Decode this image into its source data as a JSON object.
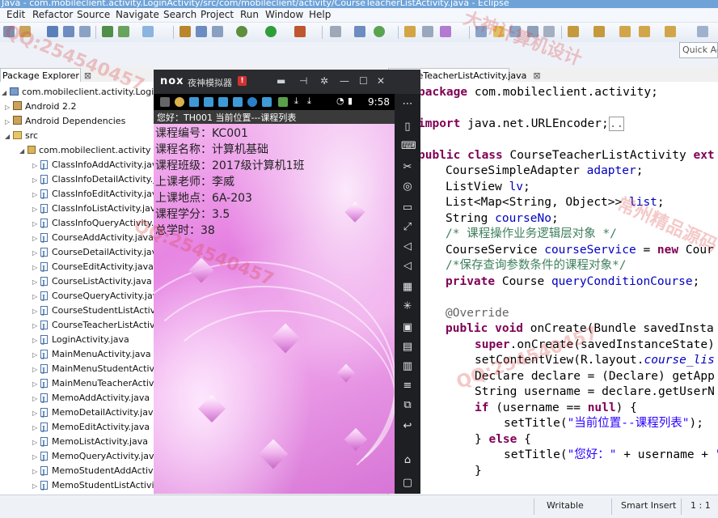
{
  "window": {
    "title": "Java - com.mobileclient.activity.LoginActivity/src/com/mobileclient/activity/CourseTeacherListActivity.java - Eclipse"
  },
  "menubar": [
    "Edit",
    "Refactor",
    "Source",
    "Navigate",
    "Search",
    "Project",
    "Run",
    "Window",
    "Help"
  ],
  "quick_access": {
    "placeholder": "Quick Ac"
  },
  "package_explorer": {
    "tab_label": "Package Explorer",
    "close_glyph": "⊠",
    "project": "com.mobileclient.activity.LoginAct",
    "android_lib": "Android 2.2",
    "deps": "Android Dependencies",
    "src": "src",
    "package": "com.mobileclient.activity",
    "files": [
      "ClassInfoAddActivity.java",
      "ClassInfoDetailActivity.java",
      "ClassInfoEditActivity.java",
      "ClassInfoListActivity.java",
      "ClassInfoQueryActivity.java",
      "CourseAddActivity.java",
      "CourseDetailActivity.java",
      "CourseEditActivity.java",
      "CourseListActivity.java",
      "CourseQueryActivity.java",
      "CourseStudentListActivity",
      "CourseTeacherListActivity",
      "LoginActivity.java",
      "MainMenuActivity.java",
      "MainMenuStudentActivity",
      "MainMenuTeacherActivity",
      "MemoAddActivity.java",
      "MemoDetailActivity.java",
      "MemoEditActivity.java",
      "MemoListActivity.java",
      "MemoQueryActivity.java",
      "MemoStudentAddActivity",
      "MemoStudentListActivity"
    ]
  },
  "editor": {
    "tab_label": "CourseTeacherListActivity.java",
    "close_glyph": "⊠"
  },
  "statusbar": {
    "mode": "Writable",
    "insert": "Smart Insert",
    "position": "1 : 1"
  },
  "nox": {
    "logo": "nox",
    "title": "夜神模拟器",
    "badge": "!",
    "time": "9:58",
    "action_bar": "您好：TH001  当前位置---课程列表",
    "course": [
      "课程编号：KC001",
      "课程名称：计算机基础",
      "课程班级：2017级计算机1班",
      "上课老师：李威",
      "上课地点：6A-203",
      "课程学分：3.5",
      "总学时：38"
    ]
  },
  "colors": {
    "keyword": "#7f0055",
    "field": "#0000c0",
    "comment": "#3f7f5f",
    "string": "#2a00ff",
    "accent_pink": "#e47ce0"
  },
  "watermark": [
    "QQ:254540457",
    "大神计算机设计",
    "常州精品源码"
  ]
}
